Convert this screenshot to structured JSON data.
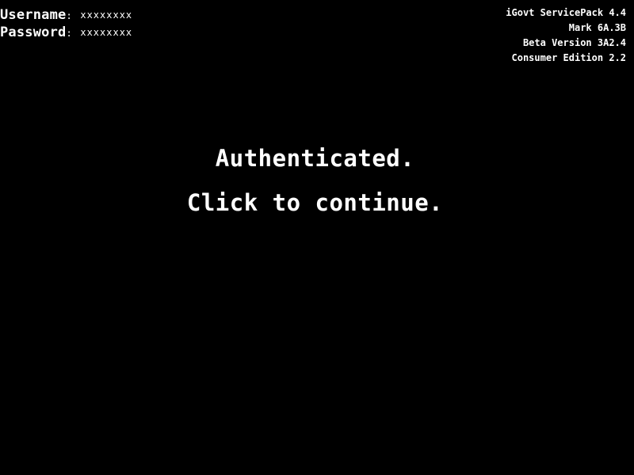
{
  "credentials": {
    "username_label": "Username",
    "password_label": "Password",
    "separator": ":",
    "username_value": "xxxxxxxx",
    "password_value": "xxxxxxxx"
  },
  "version_info": [
    "iGovt ServicePack 4.4",
    "Mark 6A.3B",
    "Beta Version 3A2.4",
    "Consumer Edition 2.2"
  ],
  "message": {
    "status": "Authenticated.",
    "prompt": "Click to continue."
  },
  "colors": {
    "background": "#000000",
    "text": "#ffffff"
  }
}
